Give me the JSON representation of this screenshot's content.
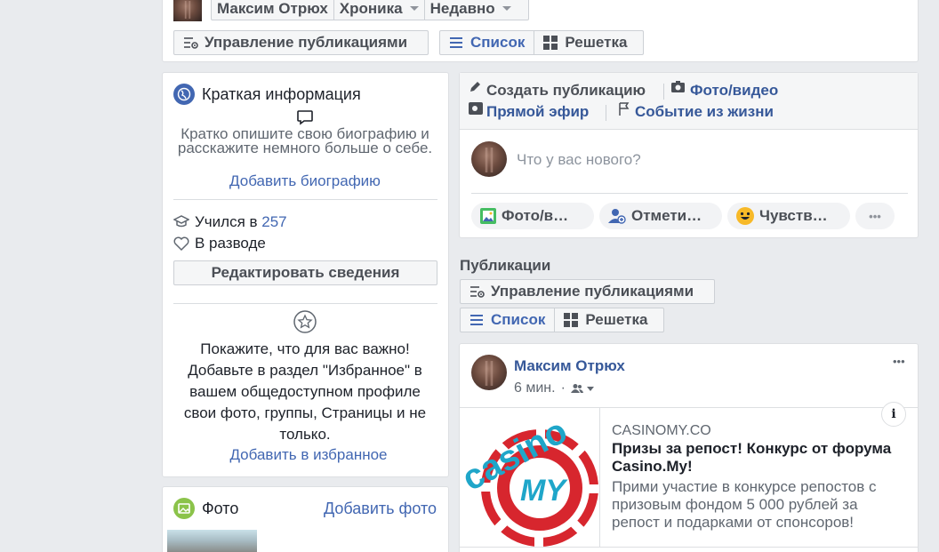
{
  "top": {
    "name": "Максим Отрюх",
    "timeline": "Хроника",
    "recent": "Недавно",
    "manage": "Управление публикациями",
    "list": "Список",
    "grid": "Решетка"
  },
  "intro": {
    "title": "Краткая информация",
    "bio_prompt": "Кратко опишите свою биографию и расскажите немного больше о себе.",
    "add_bio": "Добавить биографию",
    "studied_prefix": "Учился в ",
    "studied_value": "257",
    "relationship": "В разводе",
    "edit_details": "Редактировать сведения",
    "featured_text": "Покажите, что для вас важно! Добавьте в раздел \"Избранное\" в вашем общедоступном профиле свои фото, группы, Страницы и не только.",
    "add_featured": "Добавить в избранное"
  },
  "photos": {
    "title": "Фото",
    "add": "Добавить фото"
  },
  "composer": {
    "create_post": "Создать публикацию",
    "photo_video": "Фото/видео",
    "live": "Прямой эфир",
    "life_event": "Событие из жизни",
    "placeholder": "Что у вас нового?",
    "pill_photo": "Фото/в…",
    "pill_tag": "Отмети…",
    "pill_feeling": "Чувств…",
    "more": "•••"
  },
  "posts": {
    "heading": "Публикации",
    "manage": "Управление публикациями",
    "list": "Список",
    "grid": "Решетка"
  },
  "post": {
    "author": "Максим Отрюх",
    "time": "6 мин.",
    "sep": "·",
    "options": "•••",
    "info": "i",
    "link_domain": "CASINOMY.CO",
    "link_title": "Призы за репост! Конкурс от форума Casino.My!",
    "link_desc": "Прими участие в конкурсе репостов с призовым фондом 5 000 рублей за репост и подарками от спонсоров!",
    "logo_word": "casino",
    "logo_my": "MY"
  },
  "colors": {
    "accent": "#4267b2",
    "link": "#365899",
    "background": "#e9ebee"
  }
}
